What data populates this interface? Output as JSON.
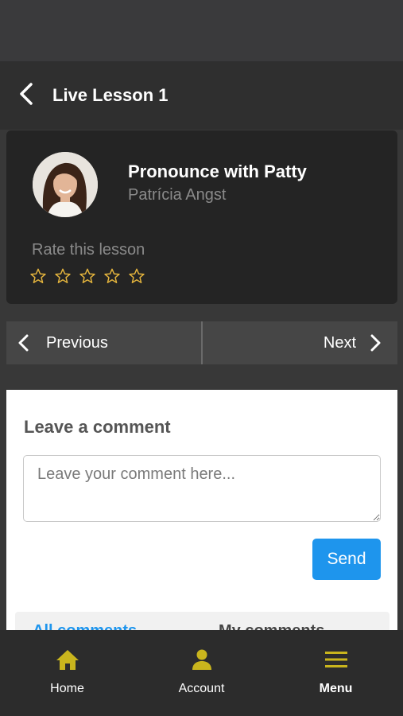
{
  "header": {
    "title": "Live Lesson 1"
  },
  "lesson": {
    "title": "Pronounce with Patty",
    "teacher": "Patrícia Angst",
    "rate_label": "Rate this lesson",
    "rating": 0,
    "rating_max": 5
  },
  "navigation": {
    "previous_label": "Previous",
    "next_label": "Next"
  },
  "comments": {
    "heading": "Leave a comment",
    "placeholder": "Leave your comment here...",
    "value": "",
    "send_label": "Send",
    "tabs": [
      {
        "label": "All comments",
        "active": true
      },
      {
        "label": "My comments",
        "active": false
      }
    ]
  },
  "bottom_nav": {
    "items": [
      {
        "label": "Home",
        "icon": "home-icon",
        "active": false
      },
      {
        "label": "Account",
        "icon": "account-icon",
        "active": false
      },
      {
        "label": "Menu",
        "icon": "menu-icon",
        "active": true
      }
    ]
  },
  "colors": {
    "accent": "#1e95ed",
    "icon_yellow": "#c9b51d",
    "star_outline": "#e5b53d",
    "card_bg": "#242424",
    "nav_button_bg": "#464646"
  }
}
